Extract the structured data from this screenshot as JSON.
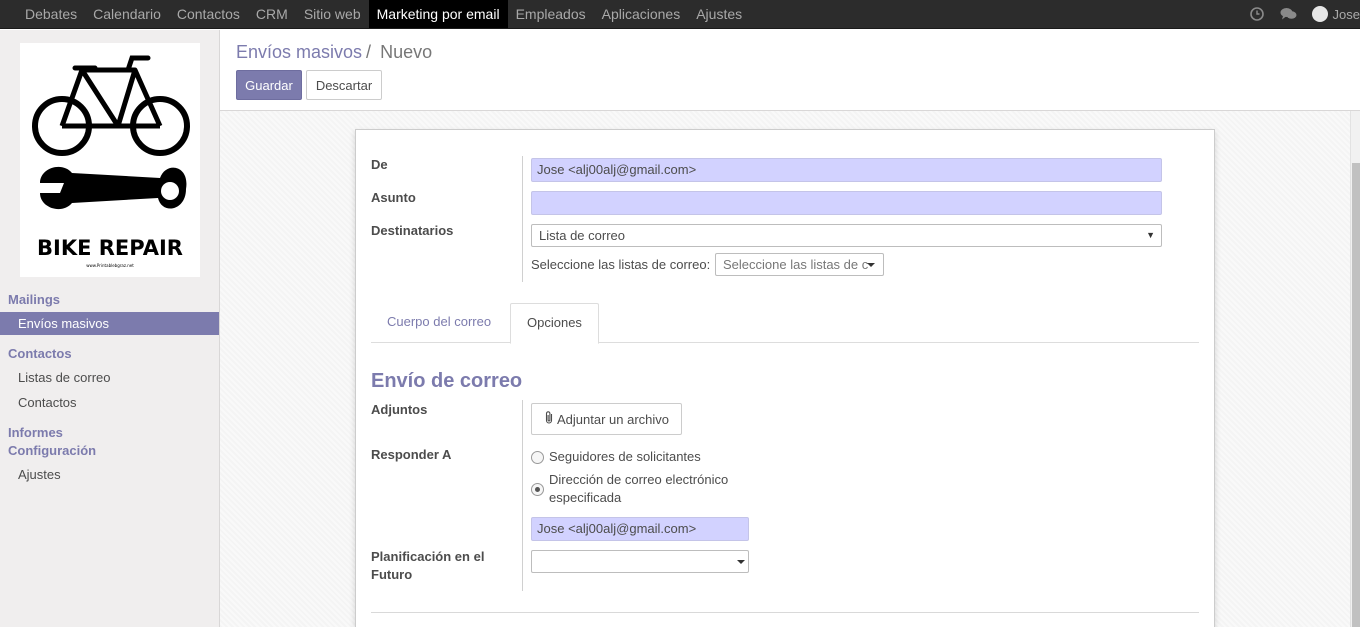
{
  "topbar": {
    "menu": [
      "Debates",
      "Calendario",
      "Contactos",
      "CRM",
      "Sitio web",
      "Marketing por email",
      "Empleados",
      "Aplicaciones",
      "Ajustes"
    ],
    "active_index": 5,
    "user": "Jose",
    "icons": [
      "clock-icon",
      "chat-icon"
    ]
  },
  "logo": {
    "text": "BIKE REPAIR",
    "small_text": "www.Printablebgraz.net"
  },
  "sidebar": {
    "section_mailings": "Mailings",
    "item_envios": "Envíos masivos",
    "section_contactos": "Contactos",
    "item_listas": "Listas de correo",
    "item_contactos": "Contactos",
    "section_informes": "Informes",
    "section_config": "Configuración",
    "item_ajustes": "Ajustes"
  },
  "control": {
    "breadcrumb_parent": "Envíos masivos",
    "breadcrumb_sep": "/",
    "breadcrumb_current": "Nuevo",
    "save_label": "Guardar",
    "discard_label": "Descartar"
  },
  "form": {
    "from_label": "De",
    "from_value": "Jose <alj00alj@gmail.com>",
    "subject_label": "Asunto",
    "subject_value": "",
    "recipients_label": "Destinatarios",
    "recipients_value": "Lista de correo",
    "lists_label": "Seleccione las listas de correo:",
    "lists_placeholder": "Seleccione las listas de c",
    "tab_body": "Cuerpo del correo",
    "tab_options": "Opciones",
    "section_title": "Envío de correo",
    "attachments_label": "Adjuntos",
    "attach_button": "Adjuntar un archivo",
    "reply_to_label": "Responder A",
    "reply_option_1": "Seguidores de solicitantes",
    "reply_option_2_line1": "Dirección de correo electrónico",
    "reply_option_2_line2": "especificada",
    "reply_to_value": "Jose <alj00alj@gmail.com>",
    "schedule_label_line1": "Planificación en el",
    "schedule_label_line2": "Futuro",
    "schedule_value": ""
  },
  "colors": {
    "accent": "#7c7bad",
    "input_required": "#d2d2ff",
    "topbar": "#2c2c2c"
  }
}
